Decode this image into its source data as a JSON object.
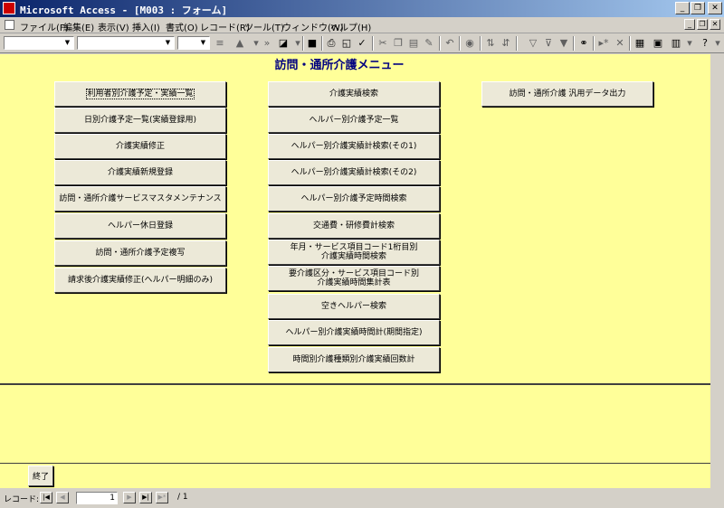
{
  "window": {
    "title": "Microsoft Access - [M003 : フォーム]",
    "minimize_glyph": "_",
    "restore_glyph": "❐",
    "close_glyph": "✕"
  },
  "menu": {
    "items": [
      "ファイル(F)",
      "編集(E)",
      "表示(V)",
      "挿入(I)",
      "書式(O)",
      "レコード(R)",
      "ツール(T)",
      "ウィンドウ(W)",
      "ヘルプ(H)"
    ]
  },
  "form": {
    "title": "訪問・通所介護メニュー",
    "left_buttons": [
      "利用者別介護予定・実績一覧",
      "日別介護予定一覧(実績登録用)",
      "介護実績修正",
      "介護実績新規登録",
      "訪問・通所介護サービスマスタメンテナンス",
      "ヘルパー休日登録",
      "訪問・通所介護予定複写",
      "請求後介護実績修正(ヘルパー明細のみ)"
    ],
    "middle_buttons": [
      "介護実績検索",
      "ヘルパー別介護予定一覧",
      "ヘルパー別介護実績計検索(その1)",
      "ヘルパー別介護実績計検索(その2)",
      "ヘルパー別介護予定時間検索",
      "交通費・研修費計検索",
      "年月・サービス項目コード1桁目別\n介護実績時間検索",
      "要介護区分・サービス項目コード別\n介護実績時間集計表",
      "空きヘルパー検索",
      "ヘルパー別介護実績時間計(期間指定)",
      "時間別介護種類別介護実績回数計"
    ],
    "right_buttons": [
      "訪問・通所介護 汎用データ出力"
    ],
    "exit_label": "終了"
  },
  "navigation": {
    "label": "レコード:",
    "current": "1",
    "total": "/ 1"
  },
  "colors": {
    "form_background": "#ffff99",
    "title_text": "#000080",
    "titlebar_start": "#0a246a",
    "titlebar_end": "#a6caf0"
  }
}
